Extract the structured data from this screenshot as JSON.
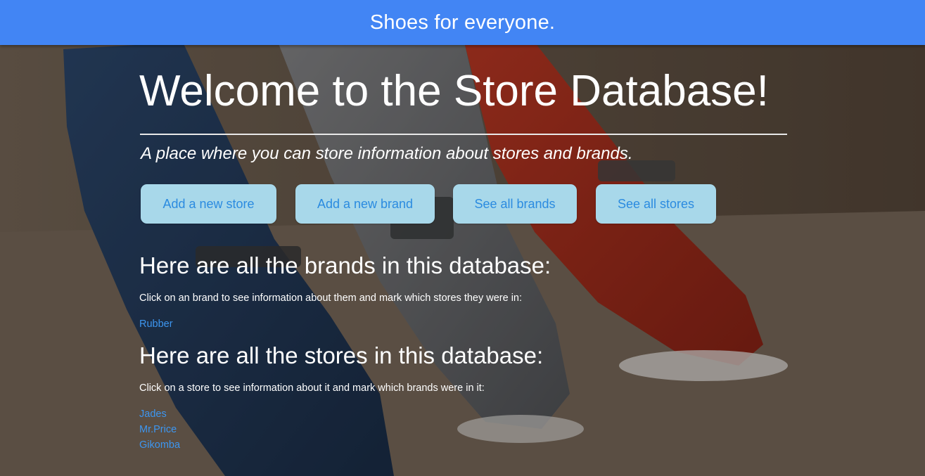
{
  "navbar": {
    "title": "Shoes for everyone."
  },
  "hero": {
    "heading": "Welcome to the Store Database!",
    "tagline": "A place where you can store information about stores and brands."
  },
  "actions": [
    {
      "label": "Add a new store"
    },
    {
      "label": "Add a new brand"
    },
    {
      "label": "See all brands"
    },
    {
      "label": "See all stores"
    }
  ],
  "brands": {
    "heading": "Here are all the brands in this database:",
    "help": "Click on an brand to see information about them and mark which stores they were in:",
    "items": [
      "Rubber"
    ]
  },
  "stores": {
    "heading": "Here are all the stores in this database:",
    "help": "Click on a store to see information about it and mark which brands were in it:",
    "items": [
      "Jades",
      "Mr.Price",
      "Gikomba"
    ]
  },
  "colors": {
    "navbar": "#4285f4",
    "button_bg": "#a8d8ea",
    "button_text": "#2b8be0",
    "link": "#3d96f0"
  }
}
